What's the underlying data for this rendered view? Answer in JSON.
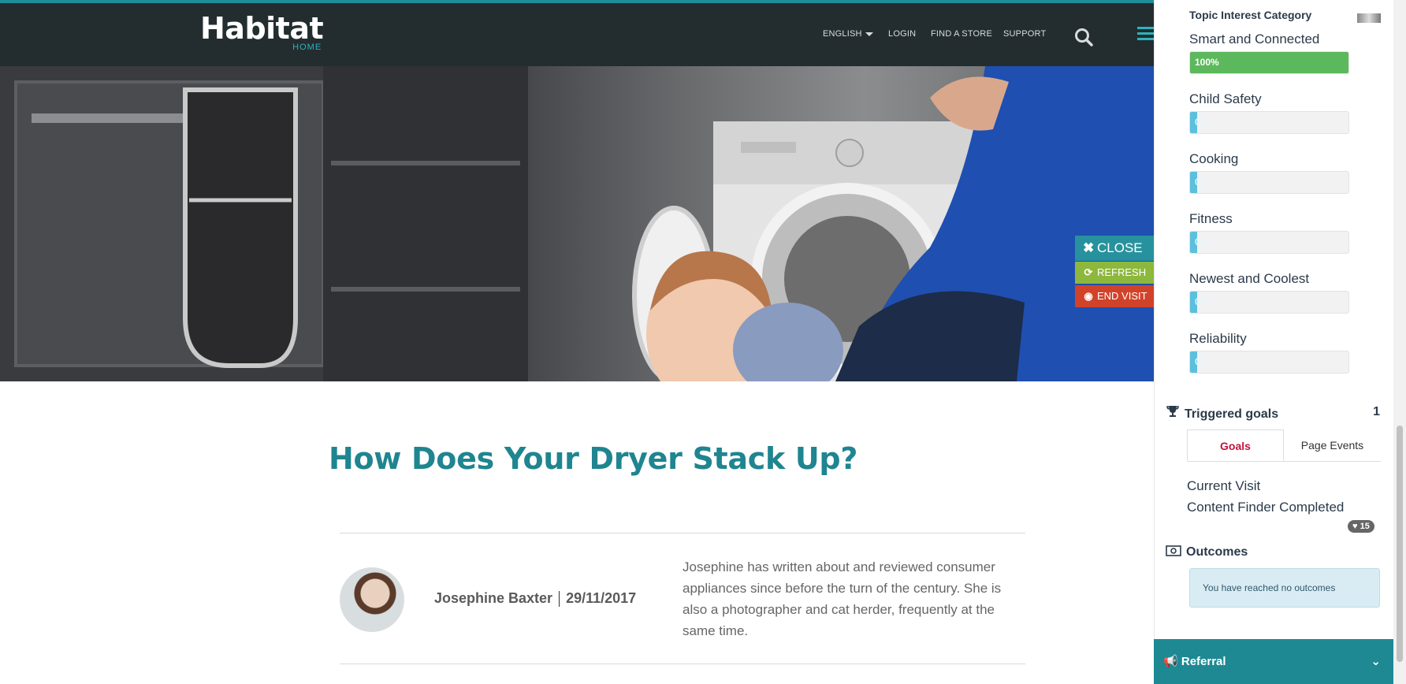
{
  "header": {
    "logo_text": "Habitat",
    "logo_sub": "HOME",
    "nav": {
      "language": "ENGLISH",
      "login": "LOGIN",
      "find_store": "FIND A STORE",
      "support": "SUPPORT"
    },
    "icons": {
      "search": "search-icon",
      "menu": "hamburger-menu-icon",
      "caret": "caret-down-icon"
    }
  },
  "side_buttons": {
    "close": "CLOSE",
    "refresh": "REFRESH",
    "end_visit": "END VISIT",
    "colors": {
      "close": "#27929d",
      "refresh": "#8db83d",
      "end_visit": "#d0432a"
    }
  },
  "article": {
    "title": "How Does Your Dryer Stack Up?",
    "author": "Josephine Baxter",
    "date": "29/11/2017",
    "bio": "Josephine has written about and reviewed consumer appliances since before the turn of the century. She is also a photographer and cat herder, frequently at the same time."
  },
  "panel": {
    "topic_header": "Topic Interest Category",
    "topics": [
      {
        "label": "Smart and Connected",
        "value": "100%",
        "fraction": 1.0,
        "color": "#5cb85c"
      },
      {
        "label": "Child Safety",
        "value": "0%",
        "fraction": 0.0,
        "color": "#5bc0de"
      },
      {
        "label": "Cooking",
        "value": "0%",
        "fraction": 0.0,
        "color": "#5bc0de"
      },
      {
        "label": "Fitness",
        "value": "0%",
        "fraction": 0.0,
        "color": "#5bc0de"
      },
      {
        "label": "Newest and Coolest",
        "value": "0%",
        "fraction": 0.0,
        "color": "#5bc0de"
      },
      {
        "label": "Reliability",
        "value": "0%",
        "fraction": 0.0,
        "color": "#5bc0de"
      }
    ],
    "goals": {
      "title": "Triggered goals",
      "count": "1",
      "tabs": [
        "Goals",
        "Page Events"
      ],
      "items": [
        "Current Visit",
        "Content Finder Completed"
      ],
      "badge": "15"
    },
    "outcomes": {
      "title": "Outcomes",
      "message": "You have reached no outcomes"
    },
    "referral": "Referral"
  }
}
